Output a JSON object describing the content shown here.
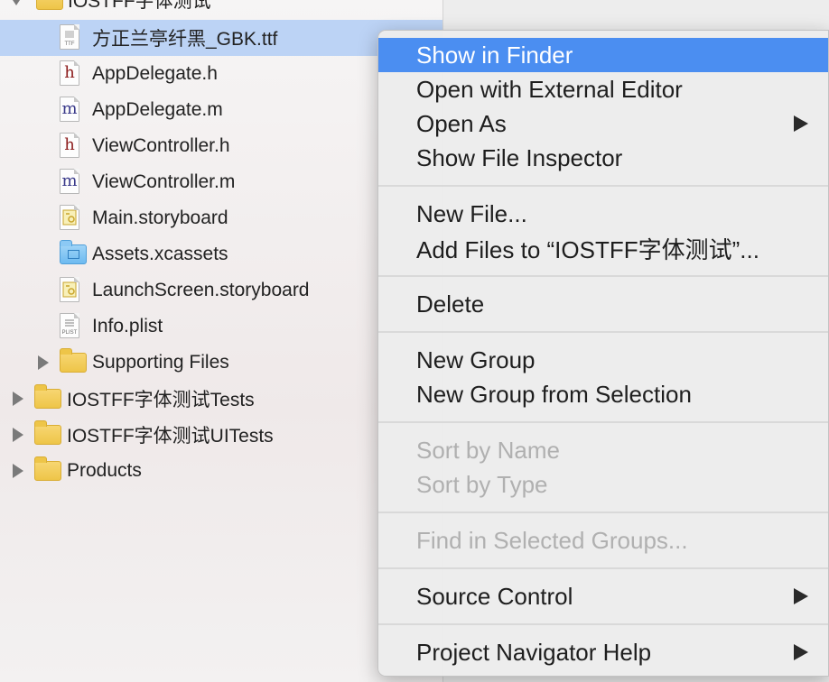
{
  "navigator": {
    "group_title": "IOSTFF字体测试",
    "files": [
      {
        "name": "方正兰亭纤黑_GBK.ttf",
        "type": "ttf",
        "icon": "ttf-file-icon"
      },
      {
        "name": "AppDelegate.h",
        "type": "h",
        "icon": "header-file-icon"
      },
      {
        "name": "AppDelegate.m",
        "type": "m",
        "icon": "implementation-file-icon"
      },
      {
        "name": "ViewController.h",
        "type": "h",
        "icon": "header-file-icon"
      },
      {
        "name": "ViewController.m",
        "type": "m",
        "icon": "implementation-file-icon"
      },
      {
        "name": "Main.storyboard",
        "type": "storyboard",
        "icon": "storyboard-file-icon"
      },
      {
        "name": "Assets.xcassets",
        "type": "assets",
        "icon": "assets-folder-icon"
      },
      {
        "name": "LaunchScreen.storyboard",
        "type": "storyboard",
        "icon": "storyboard-file-icon"
      },
      {
        "name": "Info.plist",
        "type": "plist",
        "icon": "plist-file-icon"
      },
      {
        "name": "Supporting Files",
        "type": "folder",
        "icon": "folder-icon"
      }
    ],
    "groups": [
      {
        "name": "IOSTFF字体测试Tests",
        "icon": "folder-icon"
      },
      {
        "name": "IOSTFF字体测试UITests",
        "icon": "folder-icon"
      },
      {
        "name": "Products",
        "icon": "folder-icon"
      }
    ],
    "icon_glyphs": {
      "h": "h",
      "m": "m",
      "ttf_tag": "TTF",
      "plist_tag": "PLIST"
    }
  },
  "context_menu": {
    "sections": [
      [
        {
          "label": "Show in Finder",
          "highlighted": true
        },
        {
          "label": "Open with External Editor"
        },
        {
          "label": "Open As",
          "submenu": true
        },
        {
          "label": "Show File Inspector"
        }
      ],
      [
        {
          "label": "New File..."
        },
        {
          "label": "Add Files to “IOSTFF字体测试”..."
        }
      ],
      [
        {
          "label": "Delete"
        }
      ],
      [
        {
          "label": "New Group"
        },
        {
          "label": "New Group from Selection"
        }
      ],
      [
        {
          "label": "Sort by Name",
          "disabled": true
        },
        {
          "label": "Sort by Type",
          "disabled": true
        }
      ],
      [
        {
          "label": "Find in Selected Groups...",
          "disabled": true
        }
      ],
      [
        {
          "label": "Source Control",
          "submenu": true
        }
      ],
      [
        {
          "label": "Project Navigator Help",
          "submenu": true
        }
      ]
    ]
  },
  "colors": {
    "selection_highlight": "#4b8ef1",
    "row_selected": "#bcd3f5",
    "disabled_text": "#b0b0b0",
    "header_glyph": "#8b1a1a",
    "impl_glyph": "#3a3a8a"
  }
}
